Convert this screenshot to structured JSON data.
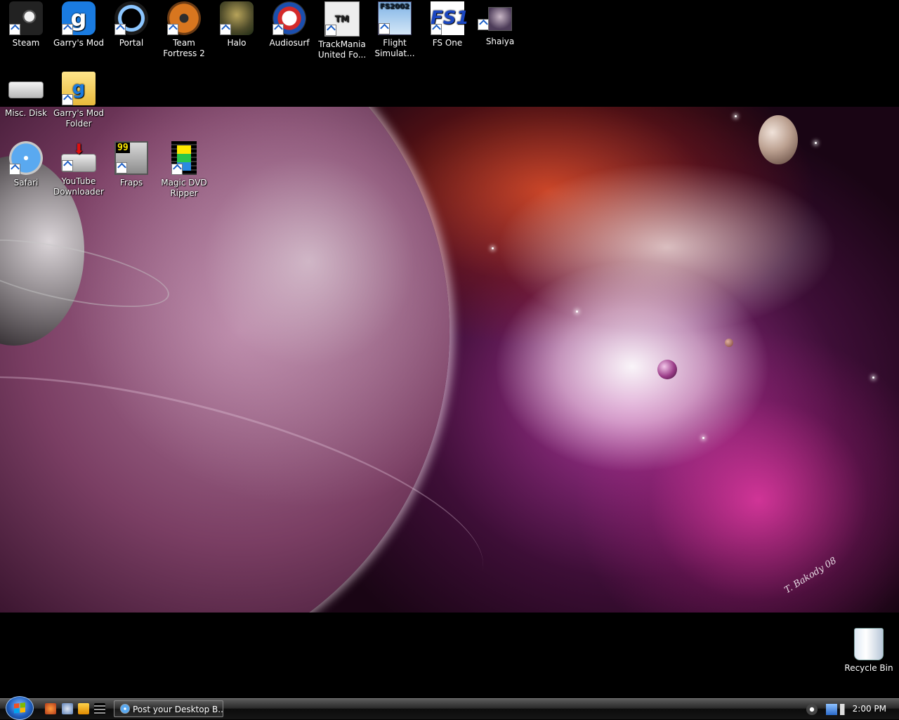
{
  "desktop_icons": [
    {
      "label": "Steam"
    },
    {
      "label": "Garry's Mod"
    },
    {
      "label": "Portal"
    },
    {
      "label": "Team Fortress 2"
    },
    {
      "label": "Halo"
    },
    {
      "label": "Audiosurf"
    },
    {
      "label": "TrackMania United Fo..."
    },
    {
      "label": "Flight Simulat..."
    },
    {
      "label": "FS One"
    },
    {
      "label": "Shaiya"
    },
    {
      "label": "Misc. Disk"
    },
    {
      "label": "Garry's Mod Folder"
    },
    {
      "label": "Safari"
    },
    {
      "label": "YouTube Downloader"
    },
    {
      "label": "Fraps"
    },
    {
      "label": "Magic DVD Ripper"
    },
    {
      "label": "Recycle Bin"
    }
  ],
  "icon_glyphs": {
    "gmod": "g",
    "folder": "g",
    "trackmania": "TM",
    "fs2002": "FS2002",
    "fsone": "FS1",
    "fraps": "99",
    "ytd_arrow": "⬇"
  },
  "wallpaper": {
    "signature": "T. Bakody 08"
  },
  "taskbar": {
    "task_button_label": "Post your Desktop B...",
    "clock": "2:00 PM"
  },
  "colors": {
    "taskbar_dark": "#0c0c0c",
    "start_orb": "#1f5fbf"
  }
}
